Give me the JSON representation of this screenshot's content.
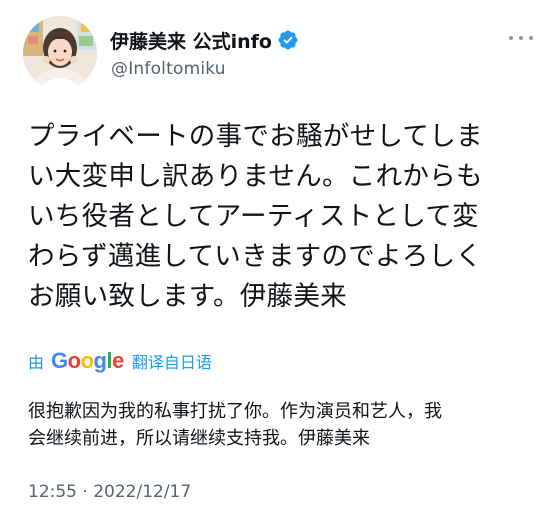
{
  "tweet": {
    "author": {
      "display_name": "伊藤美来 公式info",
      "handle": "@Infoltomiku",
      "verified": true
    },
    "text_lines": [
      "プライベートの事でお騒がせしてしま",
      "い大変申し訳ありません。これからも",
      "いち役者としてアーティストとして変",
      "わらず邁進していきますのでよろしく",
      "お願い致します。伊藤美来"
    ],
    "translation": {
      "by_label": "由",
      "provider_letters": [
        "G",
        "o",
        "o",
        "g",
        "l",
        "e"
      ],
      "action_label": "翻译自日语",
      "text_lines": [
        "很抱歉因为我的私事打扰了你。作为演员和艺人，我",
        "会继续前进，所以请继续支持我。伊藤美来"
      ]
    },
    "timestamp": "12:55 · 2022/12/17"
  },
  "icons": {
    "verified": "verified-badge-icon",
    "more": "more-options-icon",
    "avatar": "profile-photo"
  },
  "colors": {
    "accent": "#1d9bf0",
    "text_primary": "#0f1419",
    "text_secondary": "#536471"
  }
}
